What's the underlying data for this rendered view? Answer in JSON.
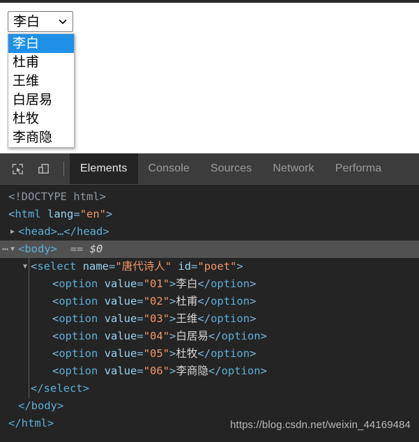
{
  "page": {
    "select": {
      "name": "select-poet",
      "selected_label": "李白",
      "arrow_icon": "chevron-down-icon",
      "options": [
        {
          "value": "01",
          "label": "李白",
          "selected": true
        },
        {
          "value": "02",
          "label": "杜甫",
          "selected": false
        },
        {
          "value": "03",
          "label": "王维",
          "selected": false
        },
        {
          "value": "04",
          "label": "白居易",
          "selected": false
        },
        {
          "value": "05",
          "label": "杜牧",
          "selected": false
        },
        {
          "value": "06",
          "label": "李商隐",
          "selected": false
        }
      ]
    }
  },
  "devtools": {
    "toolbar": {
      "inspect_icon": "inspect-element-icon",
      "device_icon": "device-toolbar-icon",
      "tabs": [
        {
          "label": "Elements",
          "active": true
        },
        {
          "label": "Console",
          "active": false
        },
        {
          "label": "Sources",
          "active": false
        },
        {
          "label": "Network",
          "active": false
        },
        {
          "label": "Performa",
          "active": false
        }
      ]
    },
    "dom": {
      "doctype": "<!DOCTYPE html>",
      "html_open_lt": "<",
      "html_tag": "html",
      "html_attr": "lang",
      "html_attr_value": "\"en\"",
      "html_open_gt": ">",
      "head_collapsed": "<head>…</head>",
      "body_open": "<body>",
      "body_marker_eq": "==",
      "body_marker_ref": "$0",
      "select_tag": "select",
      "select_attr_name": "name",
      "select_attr_name_value": "\"唐代诗人\"",
      "select_attr_id": "id",
      "select_attr_id_value": "\"poet\"",
      "option_tag": "option",
      "option_attr": "value",
      "close_select": "</select>",
      "close_body": "</body>",
      "close_html": "</html>",
      "lines": [
        {
          "value": "\"01\"",
          "text": "李白"
        },
        {
          "value": "\"02\"",
          "text": "杜甫"
        },
        {
          "value": "\"03\"",
          "text": "王维"
        },
        {
          "value": "\"04\"",
          "text": "白居易"
        },
        {
          "value": "\"05\"",
          "text": "杜牧"
        },
        {
          "value": "\"06\"",
          "text": "李商隐"
        }
      ]
    }
  },
  "watermark": {
    "text": "https://blog.csdn.net/weixin_44169484"
  },
  "colors": {
    "select_highlight": "#1e90e8",
    "devtools_bg": "#242424",
    "toolbar_bg": "#3c3c3c",
    "row_selected_bg": "#515151",
    "tag_color": "#5db0d7",
    "attr_value_color": "#f29766"
  }
}
